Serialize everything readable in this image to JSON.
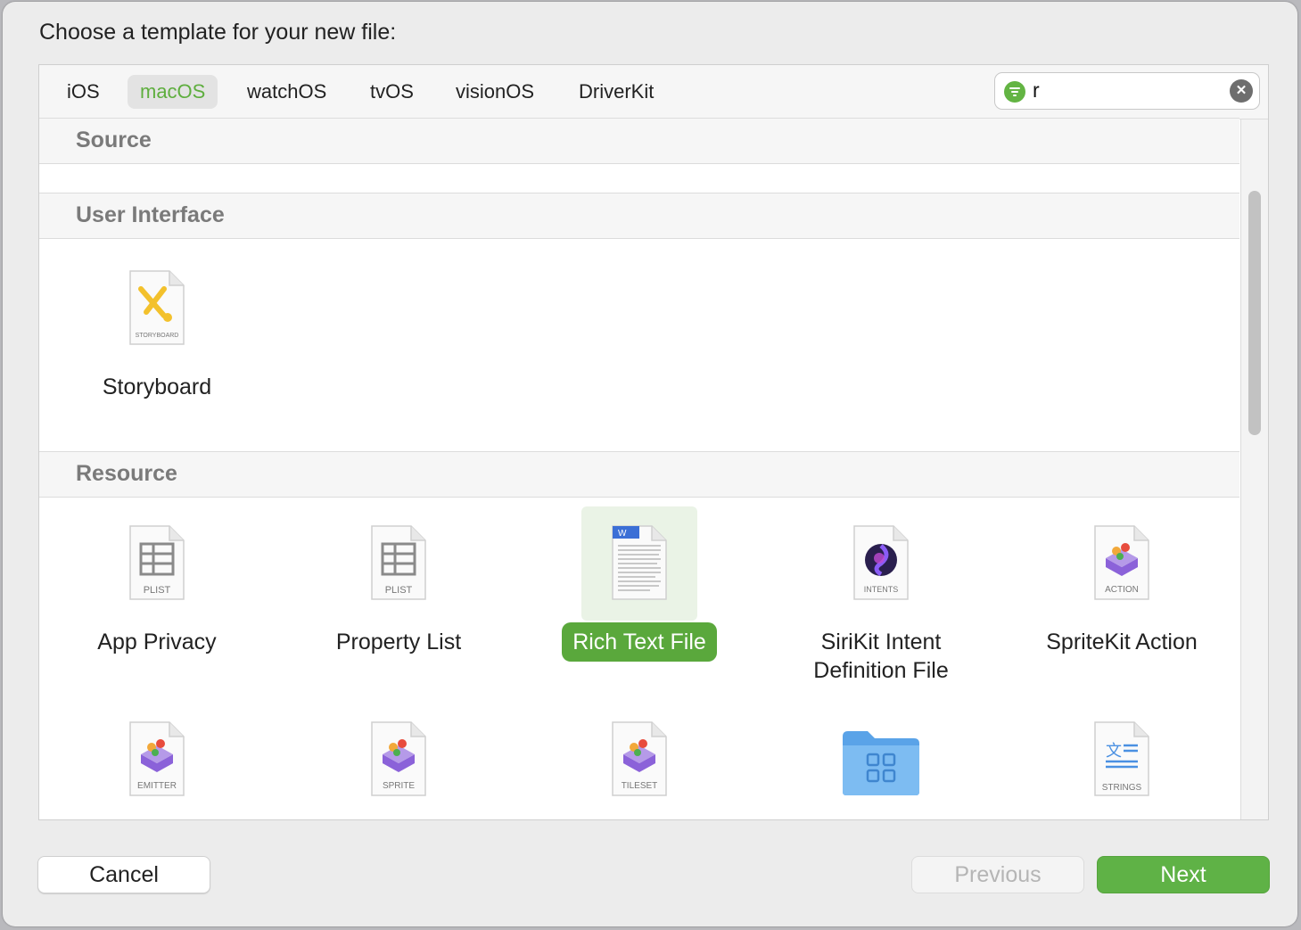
{
  "prompt": "Choose a template for your new file:",
  "tabs": [
    {
      "label": "iOS",
      "active": false
    },
    {
      "label": "macOS",
      "active": true
    },
    {
      "label": "watchOS",
      "active": false
    },
    {
      "label": "tvOS",
      "active": false
    },
    {
      "label": "visionOS",
      "active": false
    },
    {
      "label": "DriverKit",
      "active": false
    }
  ],
  "search": {
    "value": "r",
    "filter_icon": "filter-icon",
    "clear_icon": "clear-icon"
  },
  "sections": {
    "source": {
      "title": "Source"
    },
    "user_interface": {
      "title": "User Interface",
      "items": [
        {
          "label": "Storyboard",
          "badge": "STORYBOARD",
          "icon": "storyboard-icon"
        }
      ]
    },
    "resource": {
      "title": "Resource",
      "items": [
        {
          "label": "App Privacy",
          "badge": "PLIST",
          "icon": "plist-icon"
        },
        {
          "label": "Property List",
          "badge": "PLIST",
          "icon": "plist-icon"
        },
        {
          "label": "Rich Text File",
          "badge": "",
          "icon": "rich-text-icon",
          "selected": true
        },
        {
          "label": "SiriKit Intent Definition File",
          "line1": "SiriKit Intent",
          "line2": "Definition File",
          "badge": "INTENTS",
          "icon": "intents-icon"
        },
        {
          "label": "SpriteKit Action",
          "badge": "ACTION",
          "icon": "spritekit-icon"
        },
        {
          "badge": "EMITTER",
          "icon": "spritekit-icon"
        },
        {
          "badge": "SPRITE",
          "icon": "spritekit-icon"
        },
        {
          "badge": "TILESET",
          "icon": "spritekit-icon"
        },
        {
          "badge": "",
          "icon": "folder-icon"
        },
        {
          "badge": "STRINGS",
          "icon": "strings-icon"
        }
      ]
    }
  },
  "buttons": {
    "cancel": "Cancel",
    "previous": "Previous",
    "next": "Next"
  },
  "colors": {
    "accent": "#5aa83c",
    "section_header": "#7a7a7a"
  }
}
